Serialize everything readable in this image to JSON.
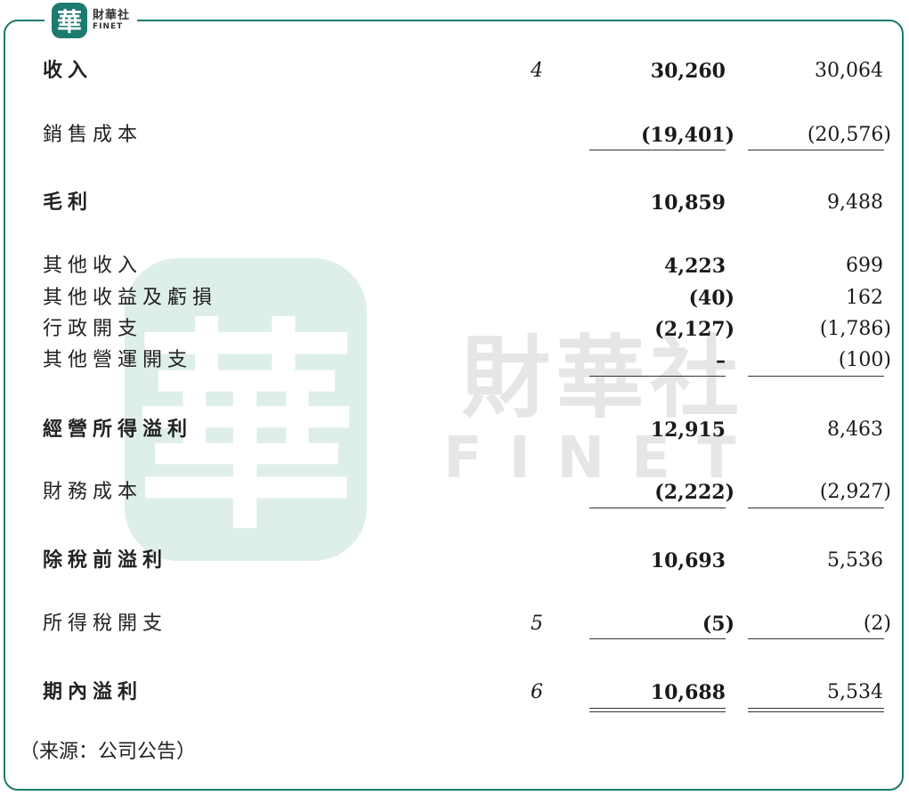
{
  "logo": {
    "seal_char": "華",
    "name_zh": "財華社",
    "name_en": "FINET"
  },
  "watermark": {
    "seal_char": "華",
    "name_zh": "財華社",
    "name_en": "FINET"
  },
  "colors": {
    "brand": "#1d7a6e",
    "watermark_seal": "#d6ebe7",
    "watermark_text": "#e6e6e6"
  },
  "rows": [
    {
      "label": "收入",
      "note": "4",
      "current": "30,260",
      "prior": "30,064"
    },
    {
      "label": "銷售成本",
      "note": "",
      "current": "(19,401)",
      "prior": "(20,576)"
    },
    {
      "label": "毛利",
      "note": "",
      "current": "10,859",
      "prior": "9,488"
    },
    {
      "label": "其他收入",
      "note": "",
      "current": "4,223",
      "prior": "699"
    },
    {
      "label": "其他收益及虧損",
      "note": "",
      "current": "(40)",
      "prior": "162"
    },
    {
      "label": "行政開支",
      "note": "",
      "current": "(2,127)",
      "prior": "(1,786)"
    },
    {
      "label": "其他營運開支",
      "note": "",
      "current": "–",
      "prior": "(100)"
    },
    {
      "label": "經營所得溢利",
      "note": "",
      "current": "12,915",
      "prior": "8,463"
    },
    {
      "label": "財務成本",
      "note": "",
      "current": "(2,222)",
      "prior": "(2,927)"
    },
    {
      "label": "除稅前溢利",
      "note": "",
      "current": "10,693",
      "prior": "5,536"
    },
    {
      "label": "所得稅開支",
      "note": "5",
      "current": "(5)",
      "prior": "(2)"
    },
    {
      "label": "期內溢利",
      "note": "6",
      "current": "10,688",
      "prior": "5,534"
    }
  ],
  "source": "（来源：公司公告）"
}
